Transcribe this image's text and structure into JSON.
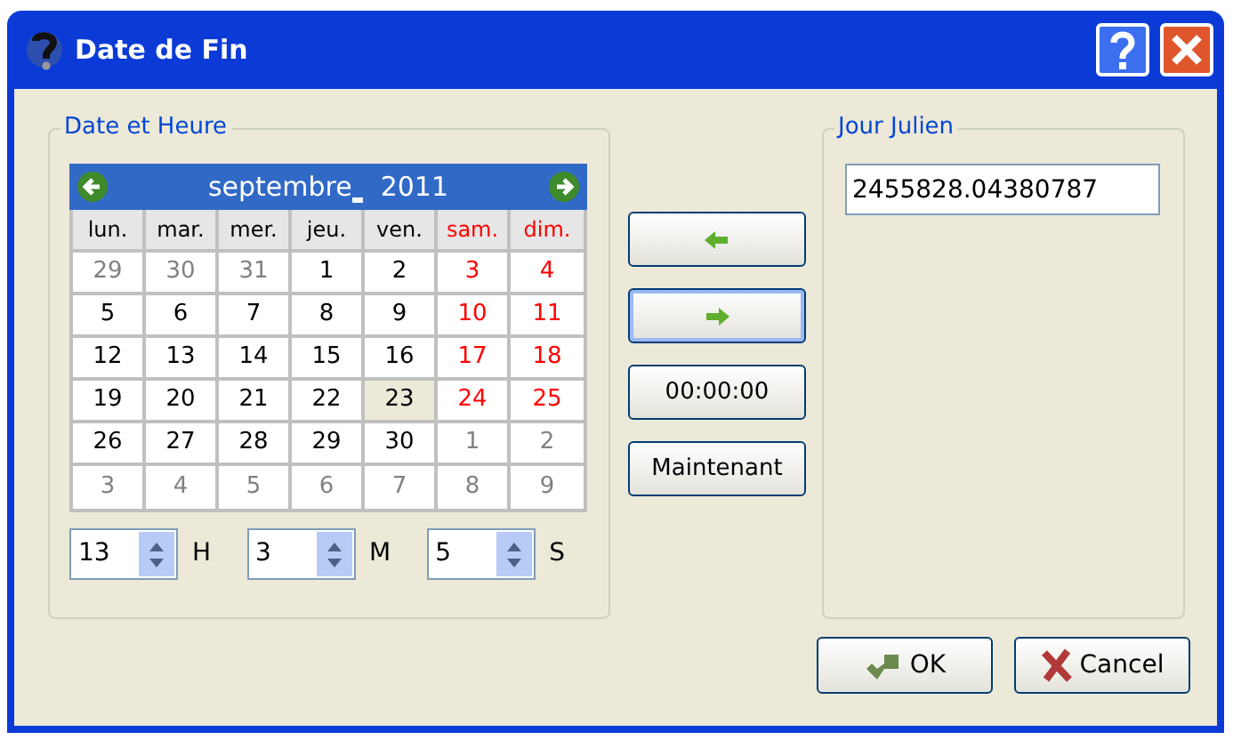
{
  "window": {
    "title": "Date de Fin"
  },
  "date_group": {
    "title": "Date et Heure"
  },
  "calendar": {
    "month": "septembre",
    "year": "2011",
    "weekdays": [
      {
        "text": "lun.",
        "kind": "weekday"
      },
      {
        "text": "mar.",
        "kind": "weekday"
      },
      {
        "text": "mer.",
        "kind": "weekday"
      },
      {
        "text": "jeu.",
        "kind": "weekday"
      },
      {
        "text": "ven.",
        "kind": "weekday"
      },
      {
        "text": "sam.",
        "kind": "weekend"
      },
      {
        "text": "dim.",
        "kind": "weekend"
      }
    ],
    "weeks": [
      [
        {
          "text": "29",
          "kind": "other",
          "selected": false
        },
        {
          "text": "30",
          "kind": "other",
          "selected": false
        },
        {
          "text": "31",
          "kind": "other",
          "selected": false
        },
        {
          "text": "1",
          "kind": "weekday",
          "selected": false
        },
        {
          "text": "2",
          "kind": "weekday",
          "selected": false
        },
        {
          "text": "3",
          "kind": "weekend",
          "selected": false
        },
        {
          "text": "4",
          "kind": "weekend",
          "selected": false
        }
      ],
      [
        {
          "text": "5",
          "kind": "weekday",
          "selected": false
        },
        {
          "text": "6",
          "kind": "weekday",
          "selected": false
        },
        {
          "text": "7",
          "kind": "weekday",
          "selected": false
        },
        {
          "text": "8",
          "kind": "weekday",
          "selected": false
        },
        {
          "text": "9",
          "kind": "weekday",
          "selected": false
        },
        {
          "text": "10",
          "kind": "weekend",
          "selected": false
        },
        {
          "text": "11",
          "kind": "weekend",
          "selected": false
        }
      ],
      [
        {
          "text": "12",
          "kind": "weekday",
          "selected": false
        },
        {
          "text": "13",
          "kind": "weekday",
          "selected": false
        },
        {
          "text": "14",
          "kind": "weekday",
          "selected": false
        },
        {
          "text": "15",
          "kind": "weekday",
          "selected": false
        },
        {
          "text": "16",
          "kind": "weekday",
          "selected": false
        },
        {
          "text": "17",
          "kind": "weekend",
          "selected": false
        },
        {
          "text": "18",
          "kind": "weekend",
          "selected": false
        }
      ],
      [
        {
          "text": "19",
          "kind": "weekday",
          "selected": false
        },
        {
          "text": "20",
          "kind": "weekday",
          "selected": false
        },
        {
          "text": "21",
          "kind": "weekday",
          "selected": false
        },
        {
          "text": "22",
          "kind": "weekday",
          "selected": false
        },
        {
          "text": "23",
          "kind": "weekday",
          "selected": true
        },
        {
          "text": "24",
          "kind": "weekend",
          "selected": false
        },
        {
          "text": "25",
          "kind": "weekend",
          "selected": false
        }
      ],
      [
        {
          "text": "26",
          "kind": "weekday",
          "selected": false
        },
        {
          "text": "27",
          "kind": "weekday",
          "selected": false
        },
        {
          "text": "28",
          "kind": "weekday",
          "selected": false
        },
        {
          "text": "29",
          "kind": "weekday",
          "selected": false
        },
        {
          "text": "30",
          "kind": "weekday",
          "selected": false
        },
        {
          "text": "1",
          "kind": "other",
          "selected": false
        },
        {
          "text": "2",
          "kind": "other",
          "selected": false
        }
      ],
      [
        {
          "text": "3",
          "kind": "other",
          "selected": false
        },
        {
          "text": "4",
          "kind": "other",
          "selected": false
        },
        {
          "text": "5",
          "kind": "other",
          "selected": false
        },
        {
          "text": "6",
          "kind": "other",
          "selected": false
        },
        {
          "text": "7",
          "kind": "other",
          "selected": false
        },
        {
          "text": "8",
          "kind": "other",
          "selected": false
        },
        {
          "text": "9",
          "kind": "other",
          "selected": false
        }
      ]
    ]
  },
  "time": [
    {
      "value": "13",
      "unit": "H"
    },
    {
      "value": "3",
      "unit": "M"
    },
    {
      "value": "5",
      "unit": "S"
    }
  ],
  "middle_buttons": [
    {
      "kind": "left"
    },
    {
      "kind": "right",
      "focused": true
    },
    {
      "kind": "text",
      "label": "00:00:00"
    },
    {
      "kind": "text",
      "label": "Maintenant"
    }
  ],
  "julian_group": {
    "title": "Jour Julien",
    "value": "2455828.04380787"
  },
  "buttons": [
    {
      "kind": "ok",
      "label": "OK"
    },
    {
      "kind": "cancel",
      "label": "Cancel"
    }
  ]
}
